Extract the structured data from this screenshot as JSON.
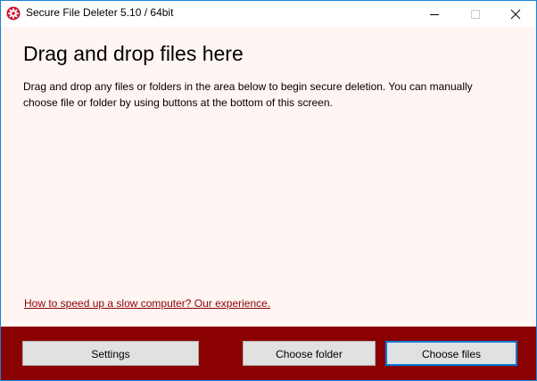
{
  "window": {
    "title": "Secure File Deleter 5.10 / 64bit",
    "app_icon": "gear-icon",
    "controls": [
      "minimize-icon",
      "maximize-icon",
      "close-icon"
    ]
  },
  "main": {
    "heading": "Drag and drop files here",
    "description": "Drag and drop any files or folders in the area below to begin secure deletion. You can manually choose file or folder by using buttons at the bottom of this screen.",
    "link_text": "How to speed up a slow computer? Our experience."
  },
  "footer": {
    "settings_label": "Settings",
    "choose_folder_label": "Choose folder",
    "choose_files_label": "Choose files"
  },
  "colors": {
    "accent": "#8b0000",
    "content_background": "#fff5f3",
    "window_border": "#1883d7"
  }
}
